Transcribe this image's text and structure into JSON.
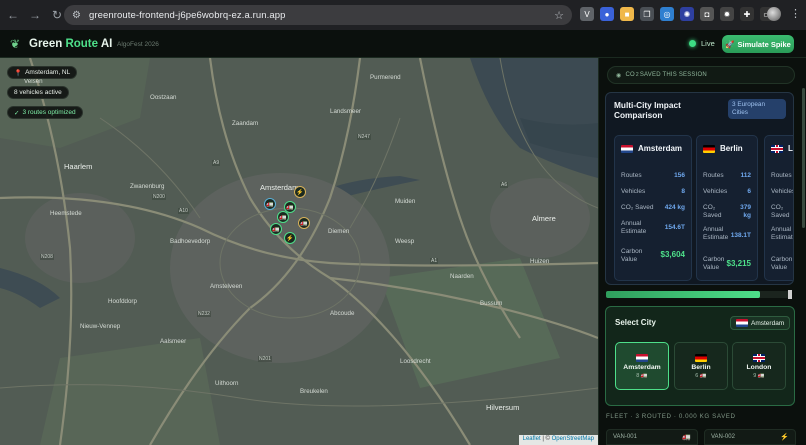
{
  "browser": {
    "url": "greenroute-frontend-j6pe6wobrq-ez.a.run.app",
    "back_icon": "arrow-left-icon",
    "forward_icon": "arrow-right-icon",
    "reload_icon": "reload-icon"
  },
  "header": {
    "brand_part1": "Green",
    "brand_part2": "Route",
    "brand_part3": "AI",
    "subtitle": "AlgoFest 2026",
    "live_label": "Live",
    "spike_button": "Simulate Spike"
  },
  "map": {
    "location_chip": "Amsterdam, NL",
    "vehicles_chip": "8 vehicles active",
    "routes_chip": "3 routes optimized",
    "attribution_leaflet": "Leaflet",
    "attribution_sep": "| ©",
    "attribution_osm": "OpenStreetMap",
    "labels": {
      "zaandam": "Zaandam",
      "haarlem": "Haarlem",
      "amsterdam": "Amsterdam",
      "amstelveen": "Amstelveen",
      "diemen": "Diemen",
      "almere": "Almere",
      "hilversum": "Hilversum",
      "hoofddorp": "Hoofddorp",
      "uithoorn": "Uithoorn",
      "heemstede": "Heemstede",
      "nieuwvennep": "Nieuw-Vennep",
      "oostzaan": "Oostzaan",
      "landsmeer": "Landsmeer",
      "purmerend": "Purmerend",
      "velsen": "Velsen",
      "weesp": "Weesp",
      "muiden": "Muiden",
      "naarden": "Naarden",
      "bussum": "Bussum",
      "badhoevedorp": "Badhoevedorp",
      "aalsmeer": "Aalsmeer",
      "abcoude": "Abcoude",
      "breukelen": "Breukelen",
      "loosdrecht": "Loosdrecht",
      "huizen": "Huizen",
      "zwanenburg": "Zwanenburg",
      "a9": "A9",
      "a10": "A10",
      "n200": "N200",
      "n208": "N208",
      "n232": "N232",
      "n201": "N201",
      "n247": "N247",
      "a1": "A1",
      "a6": "A6"
    }
  },
  "co2_pill": {
    "prefix": "CO",
    "sub": "2",
    "suffix": " SAVED THIS SESSION"
  },
  "impact": {
    "title": "Multi-City Impact Comparison",
    "badge": "3 European Cities",
    "labels": {
      "routes": "Routes",
      "vehicles": "Vehicles",
      "co2_saved": "CO₂ Saved",
      "annual_estimate": "Annual Estimate",
      "carbon_value": "Carbon Value"
    },
    "cities": [
      {
        "name": "Amsterdam",
        "flag": "nl",
        "routes": "156",
        "vehicles": "8",
        "co2_saved": "424 kg",
        "annual": "154.6T",
        "carbon_value": "$3,604"
      },
      {
        "name": "Berlin",
        "flag": "de",
        "routes": "112",
        "vehicles": "6",
        "co2_saved": "379 kg",
        "annual": "138.1T",
        "carbon_value": "$3,215"
      },
      {
        "name": "L",
        "flag": "uk",
        "routes": "",
        "vehicles": "",
        "co2_saved": "",
        "annual": "",
        "carbon_value": ""
      }
    ]
  },
  "progress": {
    "value": 0.83
  },
  "select_city": {
    "title": "Select City",
    "current": "Amsterdam",
    "options": [
      {
        "name": "Amsterdam",
        "flag": "nl",
        "count": "8 🚛"
      },
      {
        "name": "Berlin",
        "flag": "de",
        "count": "6 🚛"
      },
      {
        "name": "London",
        "flag": "uk",
        "count": "9 🚛"
      }
    ]
  },
  "fleet": {
    "title": "FLEET · 3 ROUTED · 0.000 KG SAVED",
    "vans": [
      {
        "id": "VAN-001",
        "icon": "truck-icon"
      },
      {
        "id": "VAN-002",
        "icon": "bolt-icon"
      }
    ]
  },
  "colors": {
    "accent": "#4ee08a",
    "panel_bg": "#0b100d",
    "card_bg": "#101822",
    "blue_value": "#6fa8ee"
  }
}
